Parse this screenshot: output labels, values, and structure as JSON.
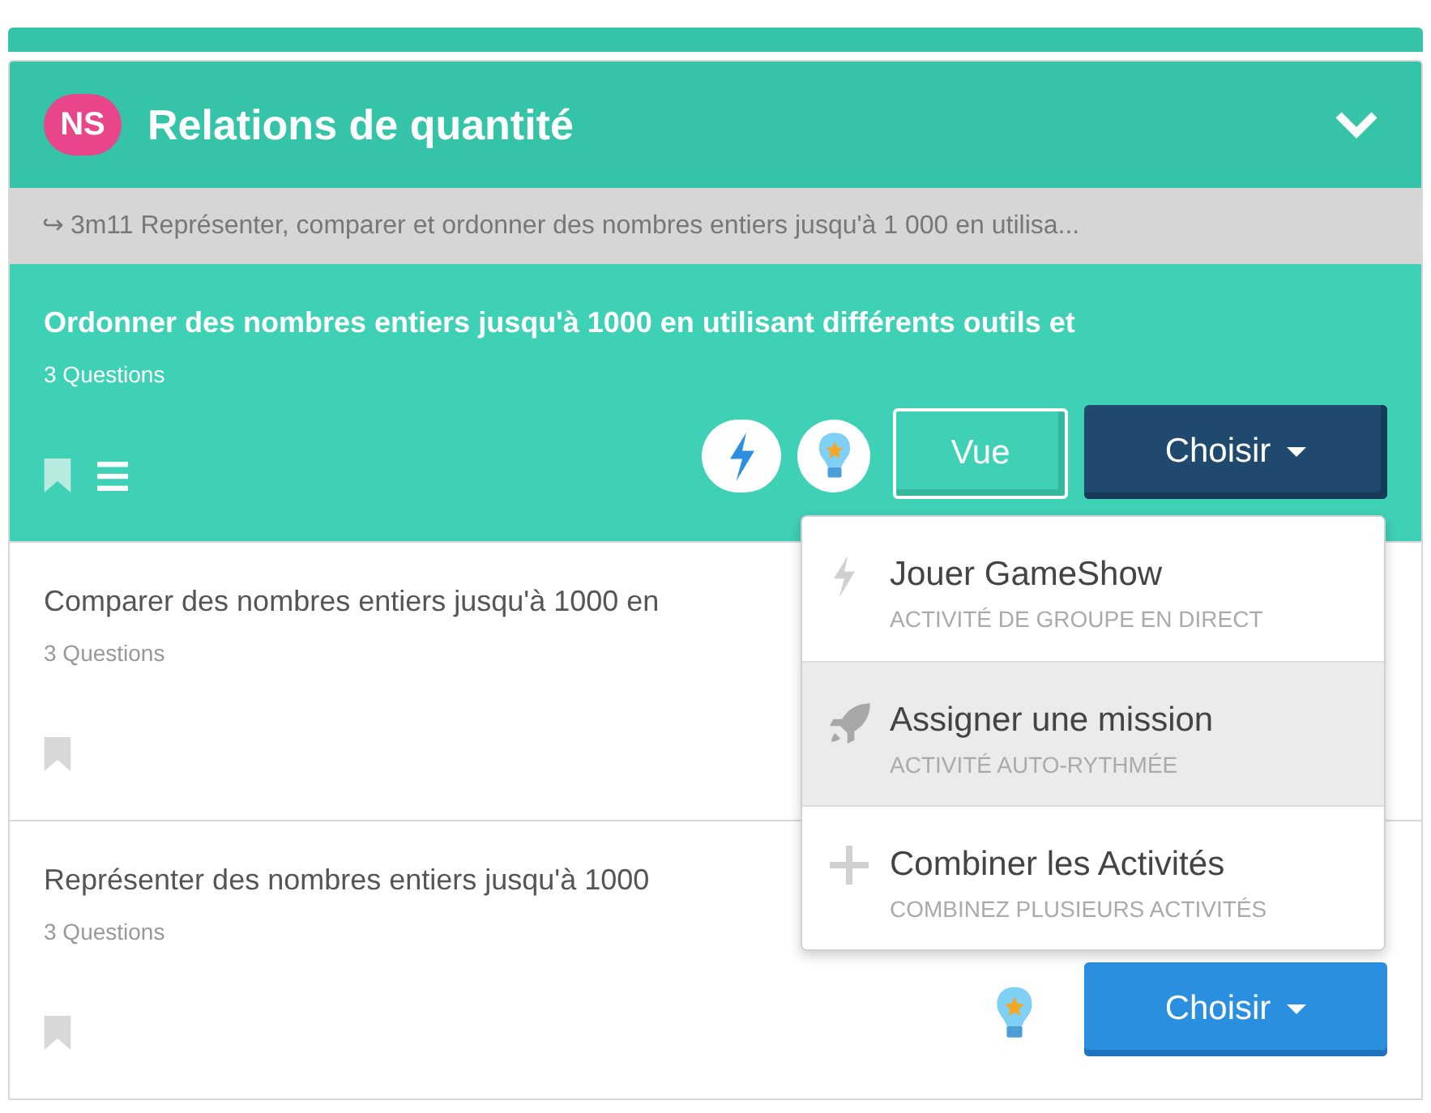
{
  "section": {
    "badge": "NS",
    "title": "Relations de quantité",
    "expanded": true
  },
  "standard": {
    "arrow": "↪",
    "text": "3m11 Représenter, comparer et ordonner des nombres entiers jusqu'à 1 000 en utilisa..."
  },
  "items": [
    {
      "title": "Ordonner des nombres entiers jusqu'à 1000 en utilisant différents outils et",
      "questions": "3 Questions",
      "selected": true,
      "list_icon": true,
      "lightning": true,
      "bulb": true,
      "view_button": "Vue",
      "choose_button": "Choisir"
    },
    {
      "title": "Comparer des nombres entiers jusqu'à 1000 en",
      "questions": "3 Questions",
      "selected": false
    },
    {
      "title": "Représenter des nombres entiers jusqu'à 1000",
      "questions": "3 Questions",
      "selected": false,
      "bulb": true,
      "choose_button": "Choisir"
    }
  ],
  "menu": [
    {
      "kind": "lightning",
      "title": "Jouer GameShow",
      "subtitle": "ACTIVITÉ DE GROUPE EN DIRECT",
      "selected": false
    },
    {
      "kind": "rocket",
      "title": "Assigner une mission",
      "subtitle": "ACTIVITÉ AUTO-RYTHMÉE",
      "selected": true
    },
    {
      "kind": "plus",
      "title": "Combiner les Activités",
      "subtitle": "COMBINEZ PLUSIEURS ACTIVITÉS",
      "selected": false
    }
  ]
}
